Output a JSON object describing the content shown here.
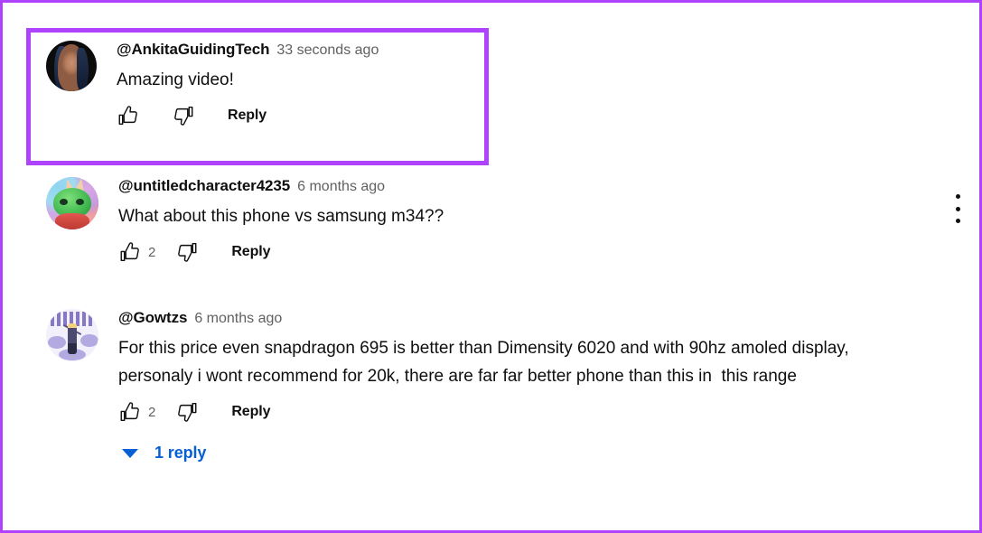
{
  "theme": {
    "highlight_color": "#AE42FF",
    "link_color": "#065FD4",
    "text_color": "#0F0F0F",
    "muted_text_color": "#606060"
  },
  "comments": [
    {
      "id": "comment-1",
      "highlighted": true,
      "avatar_name": "avatar-ankitaguidingtech",
      "author": "@AnkitaGuidingTech",
      "timestamp": "33 seconds ago",
      "text": "Amazing video!",
      "like_icon": "thumbs-up-icon",
      "like_count": "",
      "dislike_icon": "thumbs-down-icon",
      "reply_label": "Reply",
      "replies": null
    },
    {
      "id": "comment-2",
      "highlighted": false,
      "avatar_name": "avatar-untitledcharacter4235",
      "author": "@untitledcharacter4235",
      "timestamp": "6 months ago",
      "text": "What about this phone vs samsung m34??",
      "like_icon": "thumbs-up-icon",
      "like_count": "2",
      "dislike_icon": "thumbs-down-icon",
      "reply_label": "Reply",
      "replies": null
    },
    {
      "id": "comment-3",
      "highlighted": false,
      "avatar_name": "avatar-gowtzs",
      "author": "@Gowtzs",
      "timestamp": "6 months ago",
      "text": "For this price even snapdragon 695 is better than Dimensity 6020 and with 90hz amoled display, personaly i wont recommend for 20k, there are far far better phone than this in  this range",
      "like_icon": "thumbs-up-icon",
      "like_count": "2",
      "dislike_icon": "thumbs-down-icon",
      "reply_label": "Reply",
      "replies": {
        "toggle_icon": "chevron-down-icon",
        "label": "1 reply"
      }
    }
  ],
  "overflow_menu": {
    "icon": "kebab-menu-icon",
    "label": "Action menu"
  }
}
